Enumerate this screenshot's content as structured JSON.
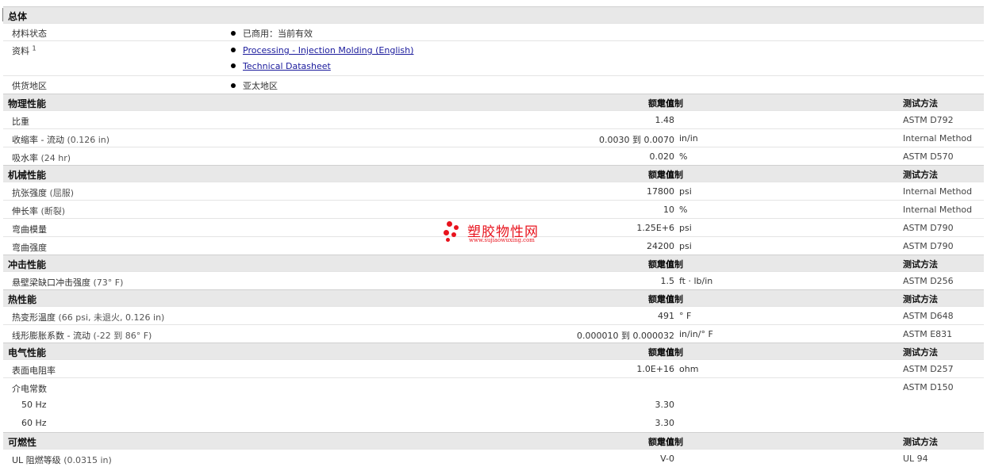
{
  "general": {
    "title": "总体",
    "rows": [
      {
        "label": "材料状态",
        "items": [
          "已商用：当前有效"
        ]
      },
      {
        "label": "资料",
        "sup": "1",
        "links": [
          "Processing - Injection Molding (English)",
          "Technical Datasheet"
        ]
      },
      {
        "label": "供货地区",
        "items": [
          "亚太地区"
        ]
      }
    ]
  },
  "headers": {
    "value": "额定值",
    "unit": "单位制",
    "test": "测试方法"
  },
  "sections": [
    {
      "title": "物理性能",
      "rows": [
        {
          "prop": "比重",
          "cond": "",
          "val": "1.48",
          "unit": "",
          "test": "ASTM D792"
        },
        {
          "prop": "收缩率 - 流动",
          "cond": "(0.126 in)",
          "val": "0.0030 到  0.0070",
          "unit": "in/in",
          "test": "Internal Method"
        },
        {
          "prop": "吸水率",
          "cond": "(24 hr)",
          "val": "0.020",
          "unit": "%",
          "test": "ASTM D570"
        }
      ]
    },
    {
      "title": "机械性能",
      "rows": [
        {
          "prop": "抗张强度",
          "cond": "(屈服)",
          "val": "17800",
          "unit": "psi",
          "test": "Internal Method"
        },
        {
          "prop": "伸长率",
          "cond": "(断裂)",
          "val": "10",
          "unit": "%",
          "test": "Internal Method"
        },
        {
          "prop": "弯曲模量",
          "cond": "",
          "val": "1.25E+6",
          "unit": "psi",
          "test": "ASTM D790"
        },
        {
          "prop": "弯曲强度",
          "cond": "",
          "val": "24200",
          "unit": "psi",
          "test": "ASTM D790"
        }
      ]
    },
    {
      "title": "冲击性能",
      "rows": [
        {
          "prop": "悬壁梁缺口冲击强度",
          "cond": "(73° F)",
          "val": "1.5",
          "unit": "ft · lb/in",
          "test": "ASTM D256"
        }
      ]
    },
    {
      "title": "热性能",
      "rows": [
        {
          "prop": "热变形温度",
          "cond": "(66 psi, 未退火, 0.126 in)",
          "val": "491",
          "unit": "° F",
          "test": "ASTM D648"
        },
        {
          "prop": "线形膨胀系数 - 流动",
          "cond": "(-22 到  86° F)",
          "val": "0.000010 到  0.000032",
          "unit": "in/in/° F",
          "test": "ASTM E831"
        }
      ]
    },
    {
      "title": "电气性能",
      "rows": [
        {
          "prop": "表面电阻率",
          "cond": "",
          "val": "1.0E+16",
          "unit": "ohm",
          "test": "ASTM D257"
        },
        {
          "prop": "介电常数",
          "cond": "",
          "val": "",
          "unit": "",
          "test": "ASTM D150"
        },
        {
          "prop": "50 Hz",
          "cond": "",
          "val": "3.30",
          "unit": "",
          "test": "",
          "sub": true
        },
        {
          "prop": "60 Hz",
          "cond": "",
          "val": "3.30",
          "unit": "",
          "test": "",
          "sub": true
        }
      ]
    },
    {
      "title": "可燃性",
      "rows": [
        {
          "prop": "UL 阻燃等级",
          "cond": "(0.0315 in)",
          "val": "V-0",
          "unit": "",
          "test": "UL 94"
        }
      ]
    }
  ],
  "watermark": {
    "name": "塑胶物性网",
    "url": "www.sujiaowuxing.com"
  }
}
